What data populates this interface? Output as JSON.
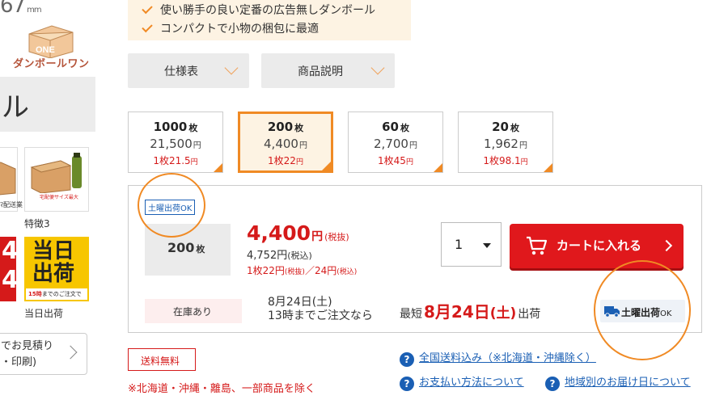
{
  "sidebar": {
    "dims_text": "67",
    "dims_unit": "mm",
    "logo_mark": "ONE",
    "logo_text": "ダンボールワン",
    "title_char": "ル",
    "thumb_text_a": "宅配便サイズ最大",
    "thumb_caption_a": "ﾏ配送業",
    "thumb_caption_b": "特徴3",
    "red_strip_text": "4\n4",
    "same_day_title": "当日\n出荷",
    "same_day_sub_bold": "15時",
    "same_day_sub_rest": "までのご注文で",
    "same_day_caption": "当日出荷",
    "estimate_label": "でお見積り\n・印刷)"
  },
  "features": {
    "items": [
      "使い勝手の良い定番の広告無しダンボール",
      "コンパクトで小物の梱包に最適"
    ]
  },
  "spec_buttons": [
    {
      "label": "仕様表"
    },
    {
      "label": "商品説明"
    }
  ],
  "quantity_options": [
    {
      "qty": "1000",
      "qty_unit": "枚",
      "price": "21,500",
      "price_unit": "円",
      "unit_label": "1枚",
      "unit_price": "21.5",
      "unit_yen": "円",
      "selected": false
    },
    {
      "qty": "200",
      "qty_unit": "枚",
      "price": "4,400",
      "price_unit": "円",
      "unit_label": "1枚",
      "unit_price": "22",
      "unit_yen": "円",
      "selected": true
    },
    {
      "qty": "60",
      "qty_unit": "枚",
      "price": "2,700",
      "price_unit": "円",
      "unit_label": "1枚",
      "unit_price": "45",
      "unit_yen": "円",
      "selected": false
    },
    {
      "qty": "20",
      "qty_unit": "枚",
      "price": "1,962",
      "price_unit": "円",
      "unit_label": "1枚",
      "unit_price": "98.1",
      "unit_yen": "円",
      "selected": false
    }
  ],
  "cart": {
    "saturday_badge": "土曜出荷OK",
    "selected_qty": "200",
    "selected_qty_unit": "枚",
    "price": "4,400",
    "price_yen": "円",
    "price_tax_note": "(税抜)",
    "price_incl": "4,752円",
    "price_incl_note": "(税込)",
    "unit_line_a": "1枚22円",
    "unit_line_a_note": "(税抜)",
    "unit_line_sep": "／",
    "unit_line_b": "24円",
    "unit_line_b_note": "(税込)",
    "quantity_value": "1",
    "add_to_cart_label": "カートに入れる",
    "stock_label": "在庫あり",
    "ship_date": "8月24日(土)",
    "ship_deadline": "13時までご注文なら",
    "earliest_prefix": "最短",
    "earliest_date": "8月24日",
    "earliest_dow": "(土)",
    "earliest_suffix": "出荷",
    "saturday_ok_label": "土曜出荷",
    "saturday_ok_suffix": "OK"
  },
  "bottom": {
    "free_shipping": "送料無料",
    "note": "※北海道・沖縄・離島、一部商品を除く",
    "links": [
      {
        "label": "全国送料込み（※北海道・沖縄除く）"
      },
      {
        "label": "お支払い方法について"
      },
      {
        "label": "地域別のお届け日について"
      }
    ]
  },
  "colors": {
    "accent_orange": "#f08a24",
    "price_red": "#d51a1a",
    "link_blue": "#1a5fb4",
    "cart_button": "#e0181c"
  }
}
